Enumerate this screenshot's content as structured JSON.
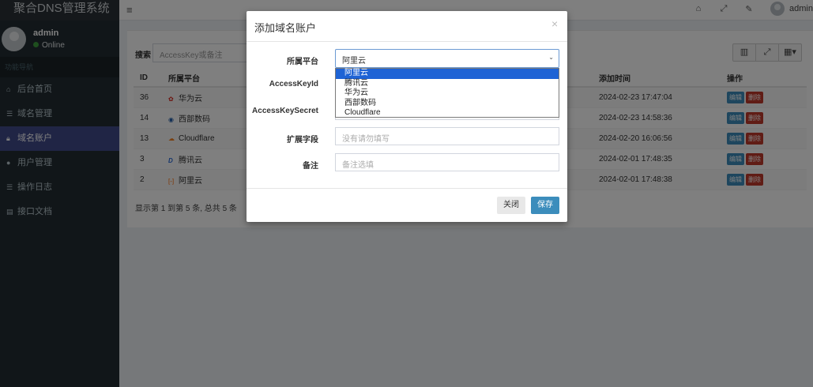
{
  "app": {
    "brand": "聚合DNS管理系统"
  },
  "topbar": {
    "user": "admin",
    "icons": [
      "home-icon",
      "expand-icon",
      "wrench-icon"
    ]
  },
  "sidebar": {
    "user_name": "admin",
    "status": "Online",
    "header": "功能导航",
    "items": [
      {
        "label": "后台首页",
        "icon": "home-icon"
      },
      {
        "label": "域名管理",
        "icon": "list-icon"
      },
      {
        "label": "域名账户",
        "icon": "lock-icon"
      },
      {
        "label": "用户管理",
        "icon": "user-icon"
      },
      {
        "label": "操作日志",
        "icon": "list-icon"
      },
      {
        "label": "接口文档",
        "icon": "book-icon"
      }
    ]
  },
  "main": {
    "search_label": "搜索",
    "search_placeholder": "AccessKey或备注",
    "columns": [
      "ID",
      "所属平台",
      "添加时间",
      "操作"
    ],
    "rows": [
      {
        "id": "36",
        "platform": "华为云",
        "time": "2024-02-23 17:47:04"
      },
      {
        "id": "14",
        "platform": "西部数码",
        "time": "2024-02-23 14:58:36"
      },
      {
        "id": "13",
        "platform": "Cloudflare",
        "time": "2024-02-20 16:06:56"
      },
      {
        "id": "3",
        "platform": "腾讯云",
        "time": "2024-02-01 17:48:35"
      },
      {
        "id": "2",
        "platform": "阿里云",
        "time": "2024-02-01 17:48:38"
      }
    ],
    "row_actions": {
      "edit": "编辑",
      "delete": "删除"
    },
    "pager_text": "显示第 1 到第 5 条, 总共 5 条"
  },
  "modal": {
    "title": "添加域名账户",
    "close_glyph": "×",
    "platform_label": "所属平台",
    "platform_value": "阿里云",
    "platform_options": [
      "阿里云",
      "腾讯云",
      "华为云",
      "西部数码",
      "Cloudflare"
    ],
    "accesskeyid_label": "AccessKeyId",
    "accesskeysecret_label": "AccessKeySecret",
    "ext_label": "扩展字段",
    "ext_placeholder": "没有请勿填写",
    "remark_label": "备注",
    "remark_placeholder": "备注选填",
    "close_button": "关闭",
    "save_button": "保存"
  }
}
